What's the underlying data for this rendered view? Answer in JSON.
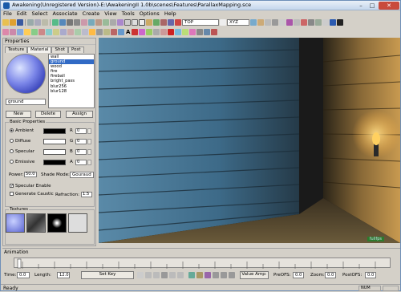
{
  "window": {
    "title": "Awakening(Unregistered Version)-E:\\AwakeningII 1.0b\\scenes\\Features\\ParallaxMapping.sce",
    "buttons": {
      "minimize": "–",
      "maximize": "□",
      "close": "✕"
    }
  },
  "menu": [
    "File",
    "Edit",
    "Select",
    "Associate",
    "Create",
    "View",
    "Tools",
    "Options",
    "Help"
  ],
  "toolbar": {
    "view_combo": "TOP",
    "axis_combo": "XYZ",
    "letter_a": "A"
  },
  "properties": {
    "title": "Properties",
    "tabs": [
      "Texture",
      "Material",
      "Shot",
      "Post"
    ],
    "active_tab": "Material",
    "materials": [
      "wall",
      "ground",
      "wood",
      "fire",
      "fireball",
      "bright_pass",
      "blur256",
      "blur128"
    ],
    "selected_material": "ground",
    "material_name": "ground",
    "buttons": {
      "new": "New",
      "delete": "Delete",
      "assign": "Assign"
    },
    "basic": {
      "label": "Basic Properties",
      "rows": [
        {
          "name": "Ambient",
          "channel": "R",
          "value": "0",
          "color": "#000000",
          "selected": true
        },
        {
          "name": "Diffuse",
          "channel": "G",
          "value": "0",
          "color": "#ffffff",
          "selected": false
        },
        {
          "name": "Specular",
          "channel": "B",
          "value": "0",
          "color": "#ffffff",
          "selected": false
        },
        {
          "name": "Emissive",
          "channel": "A",
          "value": "0",
          "color": "#000000",
          "selected": false
        }
      ],
      "power_label": "Power:",
      "power_value": "50.0",
      "shade_label": "Shade Mode:",
      "shade_value": "Gouraud",
      "specular_enable": "Specular Enable",
      "generate_caustic": "Generate Caustic",
      "refraction_label": "Refraction:",
      "refraction_value": "1.5"
    },
    "textures_label": "Textures"
  },
  "viewport": {
    "badge": "fullfps"
  },
  "animation": {
    "label": "Animation",
    "time_label": "Time:",
    "time_value": "0.0",
    "length_label": "Length:",
    "length_value": "12.0",
    "set_key": "Set Key",
    "value_amp": "Value Amp:",
    "preofs_label": "PreOFS:",
    "preofs_value": "0.0",
    "zoom_label": "Zoom:",
    "zoom_value": "0.0",
    "postofs_label": "PostOFS:",
    "postofs_value": "0.0"
  },
  "status": {
    "text": "Ready",
    "num": "NUM"
  }
}
